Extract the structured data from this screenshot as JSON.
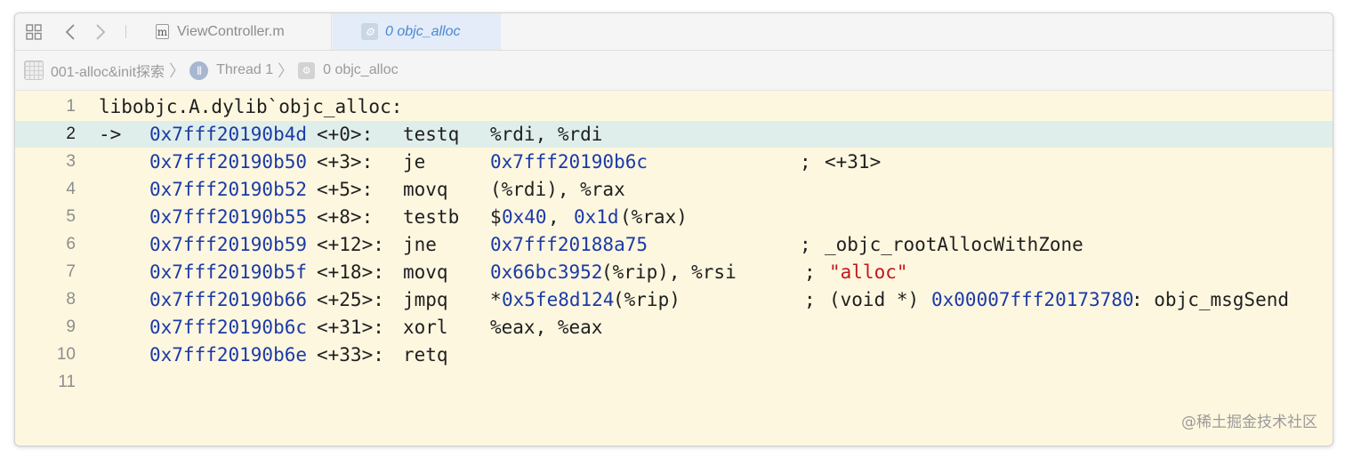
{
  "tabbar": {
    "tab1_label": "ViewController.m",
    "tab2_label": "0 objc_alloc"
  },
  "breadcrumb": {
    "project": "001-alloc&init探索",
    "thread": "Thread 1",
    "frame": "0 objc_alloc"
  },
  "code": {
    "header": "libobjc.A.dylib`objc_alloc:",
    "arrow": "->",
    "lines": [
      {
        "n": "1"
      },
      {
        "n": "2",
        "addr": "0x7fff20190b4d",
        "off": "<+0>:",
        "op": "testq",
        "a1": "%rdi, %rdi"
      },
      {
        "n": "3",
        "addr": "0x7fff20190b50",
        "off": "<+3>:",
        "op": "je",
        "a1": "0x7fff20190b6c",
        "semi": ";",
        "comment": "<+31>"
      },
      {
        "n": "4",
        "addr": "0x7fff20190b52",
        "off": "<+5>:",
        "op": "movq",
        "a1": "(%rdi), %rax"
      },
      {
        "n": "5",
        "addr": "0x7fff20190b55",
        "off": "<+8>:",
        "op": "testb",
        "a1": "$",
        "a2": "0x40",
        ",": ",",
        "a3": "0x1d",
        "a4": "(%rax)"
      },
      {
        "n": "6",
        "addr": "0x7fff20190b59",
        "off": "<+12>:",
        "op": "jne",
        "a1": "0x7fff20188a75",
        "semi": ";",
        "comment": "_objc_rootAllocWithZone"
      },
      {
        "n": "7",
        "addr": "0x7fff20190b5f",
        "off": "<+18>:",
        "op": "movq",
        "a1": "0x66bc3952",
        "a2": "(%rip), %rsi",
        "semi": ";",
        "comment": "\"alloc\""
      },
      {
        "n": "8",
        "addr": "0x7fff20190b66",
        "off": "<+25>:",
        "op": "jmpq",
        "a1": "*",
        "a2": "0x5fe8d124",
        "a3": "(%rip)",
        "semi": ";",
        "c1": "(void *)",
        "c2": "0x00007fff20173780",
        "c3": ": objc_msgSend"
      },
      {
        "n": "9",
        "addr": "0x7fff20190b6c",
        "off": "<+31>:",
        "op": "xorl",
        "a1": "%eax, %eax"
      },
      {
        "n": "10",
        "addr": "0x7fff20190b6e",
        "off": "<+33>:",
        "op": "retq"
      },
      {
        "n": "11"
      }
    ]
  },
  "watermark": "@稀土掘金技术社区",
  "colors": {
    "editor_bg": "#fdf7e0",
    "highlight": "#dfeeea",
    "address": "#1b3aa6",
    "string": "#c4171b",
    "active_tab": "#4a86d6"
  },
  "icons": [
    "grid-icon",
    "back-icon",
    "forward-icon",
    "file-m-icon",
    "gear-icon",
    "project-icon",
    "thread-icon",
    "frame-icon"
  ]
}
